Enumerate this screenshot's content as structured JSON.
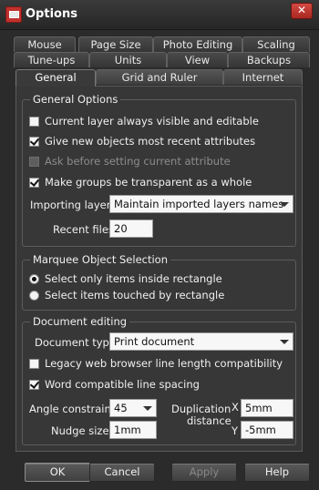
{
  "window": {
    "title": "Options",
    "close_glyph": "✕"
  },
  "tabs": {
    "row1": [
      "Mouse",
      "Page Size",
      "Photo Editing",
      "Scaling"
    ],
    "row2": [
      "Tune-ups",
      "Units",
      "View",
      "Backups"
    ],
    "row3": [
      "General",
      "Grid and Ruler",
      "Internet"
    ],
    "active": "General"
  },
  "general_options": {
    "legend": "General Options",
    "current_layer": {
      "label": "Current layer always visible and editable",
      "checked": false
    },
    "give_new_objects": {
      "label": "Give new objects most recent attributes",
      "checked": true
    },
    "ask_before": {
      "label": "Ask before setting current attribute",
      "checked": false,
      "disabled": true
    },
    "make_groups": {
      "label": "Make groups be transparent as a whole",
      "checked": true
    },
    "importing_layers_label": "Importing layers",
    "importing_layers_value": "Maintain imported layers names",
    "recent_files_label": "Recent files",
    "recent_files_value": "20"
  },
  "marquee": {
    "legend": "Marquee Object Selection",
    "option_inside": {
      "label": "Select only items inside rectangle",
      "selected": true
    },
    "option_touched": {
      "label": "Select items touched by rectangle",
      "selected": false
    }
  },
  "document_editing": {
    "legend": "Document editing",
    "document_type_label": "Document type",
    "document_type_value": "Print document",
    "legacy": {
      "label": "Legacy web browser line length compatibility",
      "checked": false
    },
    "word_compatible": {
      "label": "Word compatible line spacing",
      "checked": true
    },
    "angle_label": "Angle constraint",
    "angle_value": "45",
    "nudge_label": "Nudge size",
    "nudge_value": "1mm",
    "duplication_label_1": "Duplication",
    "duplication_label_2": "distance",
    "dup_x_label": "X",
    "dup_x_value": "5mm",
    "dup_y_label": "Y",
    "dup_y_value": "-5mm"
  },
  "buttons": {
    "ok": "OK",
    "cancel": "Cancel",
    "apply": "Apply",
    "help": "Help"
  },
  "colors": {
    "background": "#2b2b2b",
    "panel": "#373737",
    "close": "#c0322d"
  }
}
